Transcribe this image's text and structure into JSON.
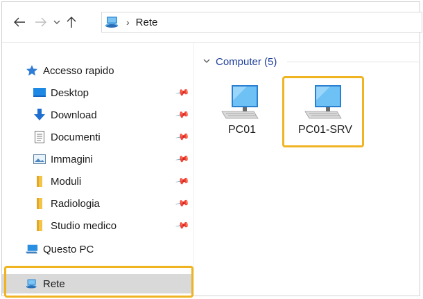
{
  "toolbar": {
    "back_icon": "arrow-left-icon",
    "forward_icon": "arrow-right-icon",
    "recent_icon": "chevron-down-icon",
    "up_icon": "arrow-up-icon"
  },
  "address": {
    "location_icon": "network-icon",
    "separator": "›",
    "crumb": "Rete"
  },
  "sidebar": {
    "items": [
      {
        "label": "Accesso rapido",
        "icon": "star-icon",
        "pinned": false
      },
      {
        "label": "Desktop",
        "icon": "desktop-folder-icon",
        "pinned": true
      },
      {
        "label": "Download",
        "icon": "download-icon",
        "pinned": true
      },
      {
        "label": "Documenti",
        "icon": "documents-icon",
        "pinned": true
      },
      {
        "label": "Immagini",
        "icon": "pictures-icon",
        "pinned": true
      },
      {
        "label": "Moduli",
        "icon": "folder-icon",
        "pinned": true
      },
      {
        "label": "Radiologia",
        "icon": "folder-icon",
        "pinned": true
      },
      {
        "label": "Studio medico",
        "icon": "folder-icon",
        "pinned": true
      },
      {
        "label": "Questo PC",
        "icon": "computer-icon",
        "pinned": false
      },
      {
        "label": "Rete",
        "icon": "network-icon",
        "pinned": false,
        "selected": true
      }
    ]
  },
  "content": {
    "group_title": "Computer (5)",
    "computers": [
      {
        "label": "PC01",
        "icon": "computer-icon"
      },
      {
        "label": "PC01-SRV",
        "icon": "computer-icon",
        "highlighted": true
      }
    ]
  },
  "colors": {
    "highlight": "#f0b321",
    "selected_bg": "#d9d9d9",
    "group_title": "#1f3f99"
  }
}
